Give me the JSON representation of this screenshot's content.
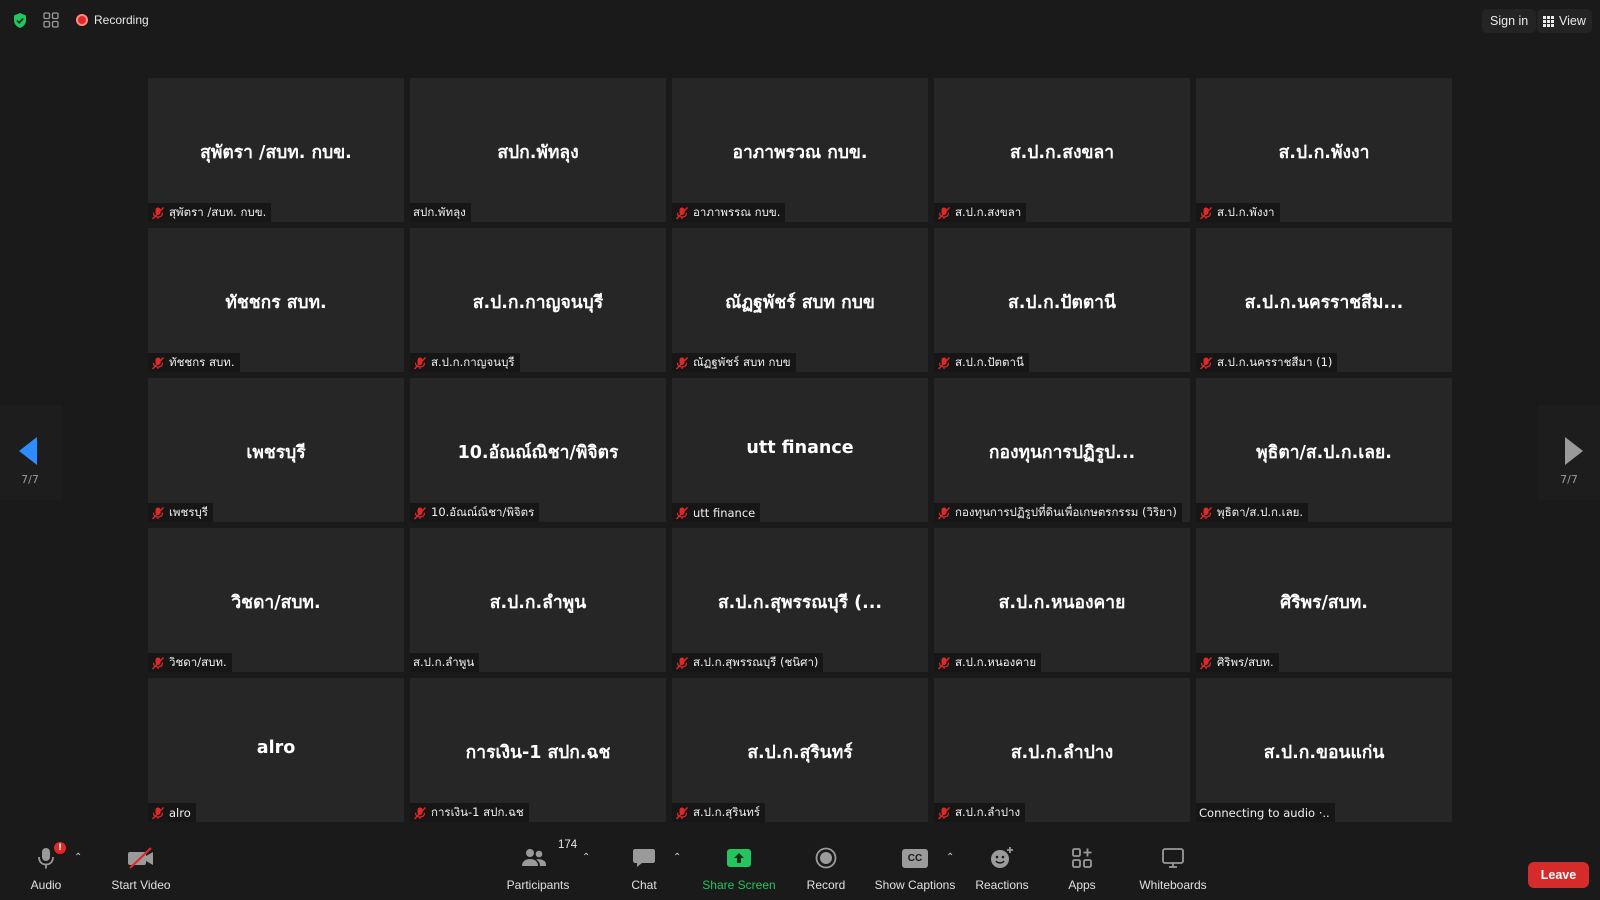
{
  "topbar": {
    "recording_label": "Recording",
    "sign_in_label": "Sign in",
    "view_label": "View"
  },
  "navigation": {
    "page_indicator_left": "7/7",
    "page_indicator_right": "7/7"
  },
  "tiles": [
    {
      "name": "สุพัตรา /สบท. กบข.",
      "label": "สุพัตรา /สบท. กบข.",
      "muted": true
    },
    {
      "name": "สปก.พัทลุง",
      "label": "สปก.พัทลุง",
      "muted": false
    },
    {
      "name": "อาภาพรวณ กบข.",
      "label": "อาภาพรรณ กบข.",
      "muted": true
    },
    {
      "name": "ส.ป.ก.สงขลา",
      "label": "ส.ป.ก.สงขลา",
      "muted": true
    },
    {
      "name": "ส.ป.ก.พังงา",
      "label": "ส.ป.ก.พังงา",
      "muted": true
    },
    {
      "name": "ทัชชกร สบท.",
      "label": "ทัชชกร สบท.",
      "muted": true
    },
    {
      "name": "ส.ป.ก.กาญจนบุรี",
      "label": "ส.ป.ก.กาญจนบุรี",
      "muted": true
    },
    {
      "name": "ณัฏฐพัชร์ สบท กบข",
      "label": "ณัฏฐพัชร์ สบท กบข",
      "muted": true
    },
    {
      "name": "ส.ป.ก.ปัตตานี",
      "label": "ส.ป.ก.ปัตตานี",
      "muted": true
    },
    {
      "name": "ส.ป.ก.นครราชสีม...",
      "label": "ส.ป.ก.นครราชสีมา (1)",
      "muted": true
    },
    {
      "name": "เพชรบุรี",
      "label": "เพชรบุรี",
      "muted": true
    },
    {
      "name": "10.อัณณ์ณิชา/พิจิตร",
      "label": "10.อัณณ์ณิชา/พิจิตร",
      "muted": true
    },
    {
      "name": "utt finance",
      "label": "utt finance",
      "muted": true
    },
    {
      "name": "กองทุนการปฏิรูป...",
      "label": "กองทุนการปฏิรูปที่ดินเพื่อเกษตรกรรม (วิริยา)",
      "muted": true
    },
    {
      "name": "พุธิตา/ส.ป.ก.เลย.",
      "label": "พุธิตา/ส.ป.ก.เลย.",
      "muted": true
    },
    {
      "name": "วิชดา/สบท.",
      "label": "วิชดา/สบท.",
      "muted": true
    },
    {
      "name": "ส.ป.ก.ลำพูน",
      "label": "ส.ป.ก.ลำพูน",
      "muted": false
    },
    {
      "name": "ส.ป.ก.สุพรรณบุรี (...",
      "label": "ส.ป.ก.สุพรรณบุรี (ชนิศา)",
      "muted": true
    },
    {
      "name": "ส.ป.ก.หนองคาย",
      "label": "ส.ป.ก.หนองคาย",
      "muted": true
    },
    {
      "name": "ศิริพร/สบท.",
      "label": "ศิริพร/สบท.",
      "muted": true
    },
    {
      "name": "alro",
      "label": "alro",
      "muted": true
    },
    {
      "name": "การเงิน-1 สปก.ฉช",
      "label": "การเงิน-1 สปก.ฉช",
      "muted": true
    },
    {
      "name": "ส.ป.ก.สุรินทร์",
      "label": "ส.ป.ก.สุรินทร์",
      "muted": true
    },
    {
      "name": "ส.ป.ก.ลำปาง",
      "label": "ส.ป.ก.ลำปาง",
      "muted": true
    },
    {
      "name": "ส.ป.ก.ขอนแก่น",
      "label": "Connecting to audio ·..",
      "muted": false
    }
  ],
  "toolbar": {
    "audio_label": "Audio",
    "audio_badge": "!",
    "start_video_label": "Start Video",
    "participants_label": "Participants",
    "participants_count": "174",
    "chat_label": "Chat",
    "share_screen_label": "Share Screen",
    "record_label": "Record",
    "show_captions_label": "Show Captions",
    "captions_icon_text": "CC",
    "reactions_label": "Reactions",
    "apps_label": "Apps",
    "whiteboards_label": "Whiteboards",
    "leave_label": "Leave"
  },
  "colors": {
    "background": "#1a1a1a",
    "tile": "#262626",
    "accent_blue": "#2d8cff",
    "share_green": "#22c55e",
    "leave_red": "#d52b2b",
    "muted_red": "#e02828"
  }
}
